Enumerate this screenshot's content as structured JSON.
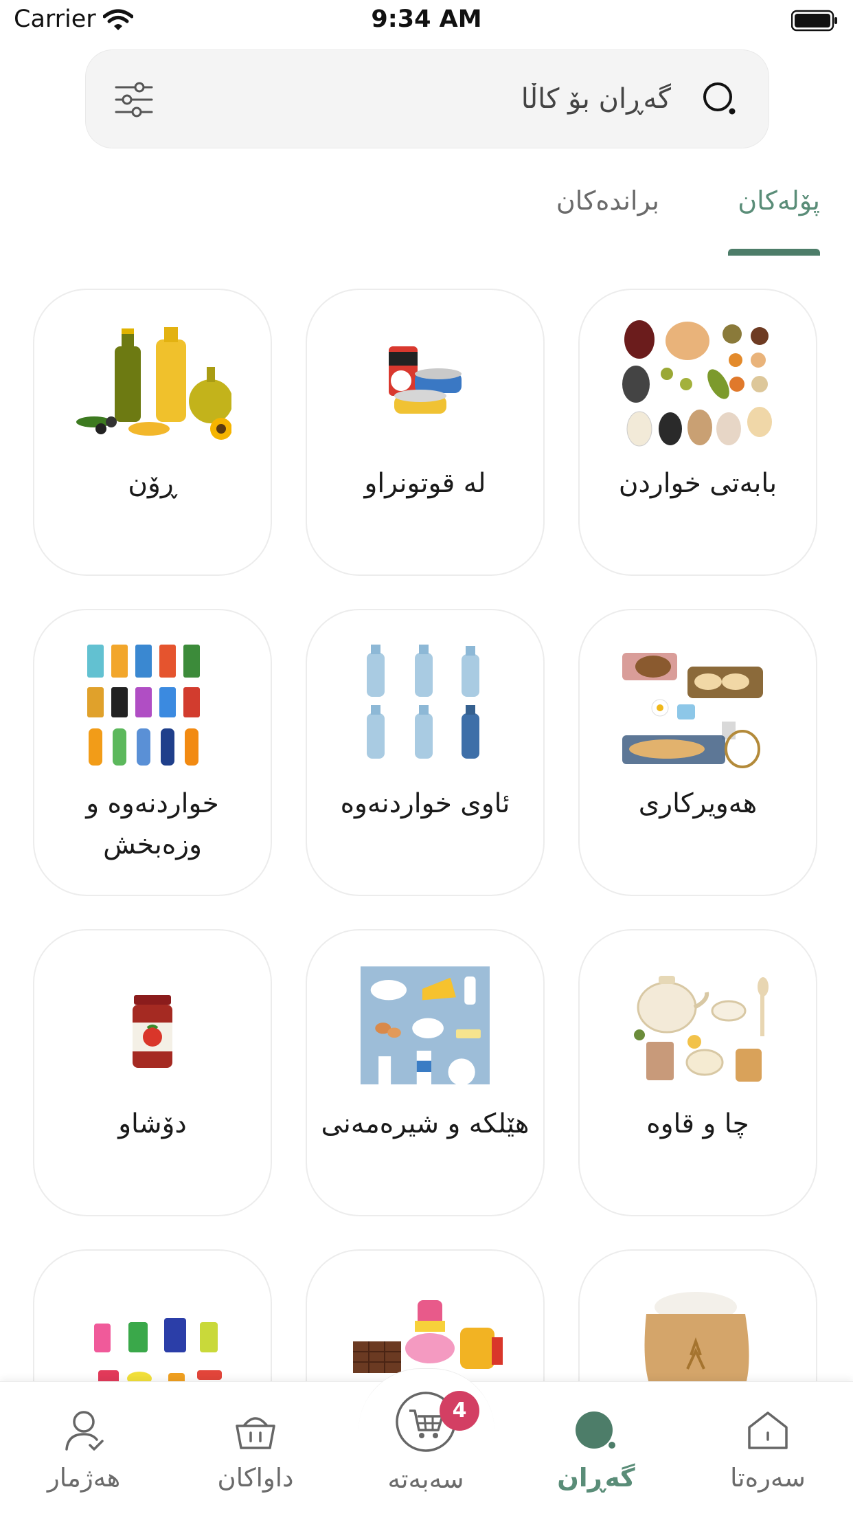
{
  "status_bar": {
    "carrier": "Carrier",
    "time": "9:34 AM"
  },
  "search": {
    "placeholder": "گەڕان بۆ کاڵا"
  },
  "tabs": [
    {
      "label": "پۆلەکان",
      "active": true
    },
    {
      "label": "براندەکان",
      "active": false
    }
  ],
  "categories": [
    {
      "label": "بابەتی خواردن",
      "icon": "legumes-image"
    },
    {
      "label": "لە قوتونراو",
      "icon": "canned-food-image"
    },
    {
      "label": "ڕۆن",
      "icon": "cooking-oil-image"
    },
    {
      "label": "هەویرکاری",
      "icon": "baking-image"
    },
    {
      "label": "ئاوی خواردنەوە",
      "icon": "water-bottles-image"
    },
    {
      "label": "خواردنەوە و وزەبخش",
      "icon": "soft-drinks-image"
    },
    {
      "label": "چا و قاوە",
      "icon": "tea-coffee-image"
    },
    {
      "label": "هێلکە و شیرەمەنی",
      "icon": "dairy-eggs-image"
    },
    {
      "label": "دۆشاو",
      "icon": "paste-jar-image"
    },
    {
      "label": "",
      "icon": "rice-sack-image"
    },
    {
      "label": "",
      "icon": "sweets-image"
    },
    {
      "label": "",
      "icon": "cleaning-products-image"
    }
  ],
  "bottom_nav": {
    "items": [
      {
        "label": "سەرەتا",
        "icon": "home-icon"
      },
      {
        "label": "گەڕان",
        "icon": "search-icon",
        "active": true
      },
      {
        "label": "سەبەتە",
        "icon": "cart-icon"
      },
      {
        "label": "داواکان",
        "icon": "basket-icon"
      },
      {
        "label": "هەژمار",
        "icon": "account-icon"
      }
    ],
    "cart_badge": "4"
  },
  "colors": {
    "accent": "#4d7d69",
    "badge": "#d33f63"
  }
}
